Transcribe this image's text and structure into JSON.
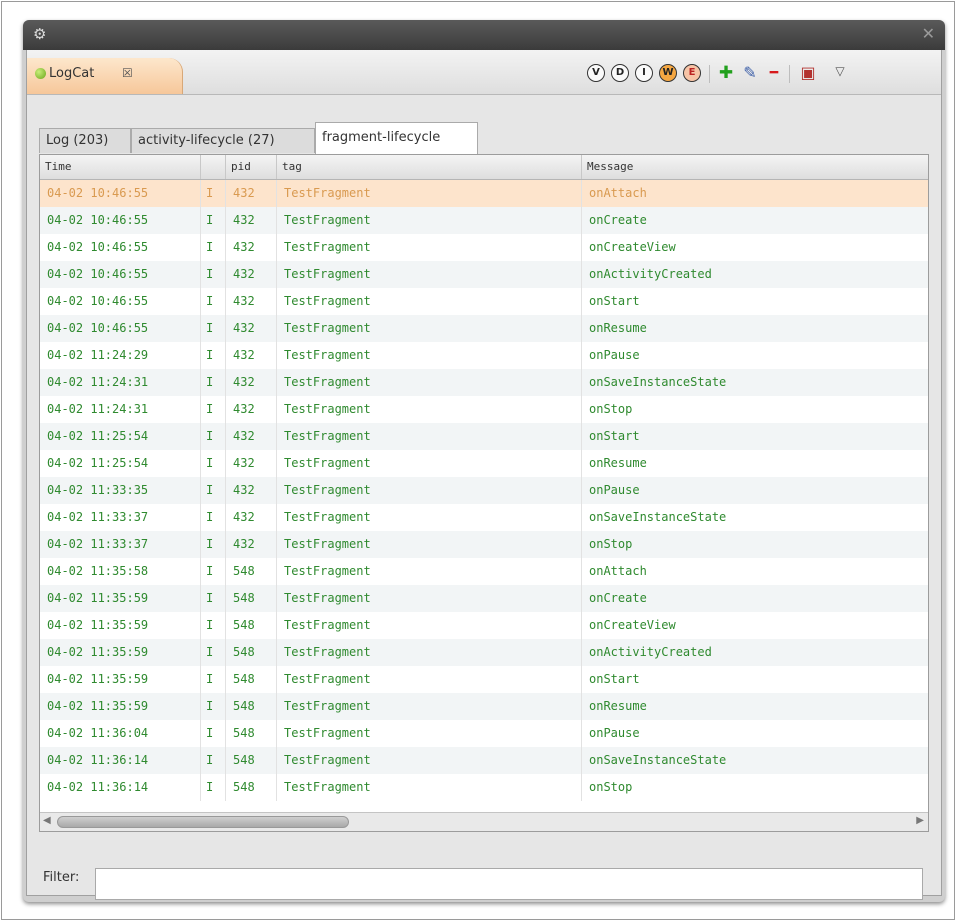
{
  "window": {
    "close_glyph": "✕",
    "app_icon": "gear-icon"
  },
  "view_tab": {
    "label": "LogCat",
    "close_glyph": "☒",
    "icon": "logcat-icon"
  },
  "toolbar": {
    "buttons": [
      {
        "name": "verbose-button",
        "glyph": "V"
      },
      {
        "name": "debug-button",
        "glyph": "D"
      },
      {
        "name": "info-button",
        "glyph": "I"
      },
      {
        "name": "warning-button",
        "glyph": "W"
      },
      {
        "name": "error-button",
        "glyph": "E"
      },
      {
        "name": "add-filter-button",
        "glyph": "✚"
      },
      {
        "name": "edit-filter-button",
        "glyph": "✎"
      },
      {
        "name": "remove-filter-button",
        "glyph": "━"
      },
      {
        "name": "clear-log-button",
        "glyph": "▣"
      },
      {
        "name": "view-menu-button",
        "glyph": "▽"
      }
    ],
    "colors": {
      "info": "#ffffff",
      "warning": "#f5a742",
      "error": "#f7c4a6",
      "add": "#22a01d",
      "remove": "#d7191c"
    }
  },
  "log_tabs": [
    {
      "label": "Log (203)",
      "active": false
    },
    {
      "label": "activity-lifecycle (27)",
      "active": false
    },
    {
      "label": "fragment-lifecycle",
      "active": true
    }
  ],
  "table": {
    "headers": {
      "time": "Time",
      "level": "",
      "pid": "pid",
      "tag": "tag",
      "message": "Message"
    },
    "rows": [
      {
        "time": "04-02 10:46:55",
        "level": "I",
        "pid": "432",
        "tag": "TestFragment",
        "message": "onAttach"
      },
      {
        "time": "04-02 10:46:55",
        "level": "I",
        "pid": "432",
        "tag": "TestFragment",
        "message": "onCreate"
      },
      {
        "time": "04-02 10:46:55",
        "level": "I",
        "pid": "432",
        "tag": "TestFragment",
        "message": "onCreateView"
      },
      {
        "time": "04-02 10:46:55",
        "level": "I",
        "pid": "432",
        "tag": "TestFragment",
        "message": "onActivityCreated"
      },
      {
        "time": "04-02 10:46:55",
        "level": "I",
        "pid": "432",
        "tag": "TestFragment",
        "message": "onStart"
      },
      {
        "time": "04-02 10:46:55",
        "level": "I",
        "pid": "432",
        "tag": "TestFragment",
        "message": "onResume"
      },
      {
        "time": "04-02 11:24:29",
        "level": "I",
        "pid": "432",
        "tag": "TestFragment",
        "message": "onPause"
      },
      {
        "time": "04-02 11:24:31",
        "level": "I",
        "pid": "432",
        "tag": "TestFragment",
        "message": "onSaveInstanceState"
      },
      {
        "time": "04-02 11:24:31",
        "level": "I",
        "pid": "432",
        "tag": "TestFragment",
        "message": "onStop"
      },
      {
        "time": "04-02 11:25:54",
        "level": "I",
        "pid": "432",
        "tag": "TestFragment",
        "message": "onStart"
      },
      {
        "time": "04-02 11:25:54",
        "level": "I",
        "pid": "432",
        "tag": "TestFragment",
        "message": "onResume"
      },
      {
        "time": "04-02 11:33:35",
        "level": "I",
        "pid": "432",
        "tag": "TestFragment",
        "message": "onPause"
      },
      {
        "time": "04-02 11:33:37",
        "level": "I",
        "pid": "432",
        "tag": "TestFragment",
        "message": "onSaveInstanceState"
      },
      {
        "time": "04-02 11:33:37",
        "level": "I",
        "pid": "432",
        "tag": "TestFragment",
        "message": "onStop"
      },
      {
        "time": "04-02 11:35:58",
        "level": "I",
        "pid": "548",
        "tag": "TestFragment",
        "message": "onAttach"
      },
      {
        "time": "04-02 11:35:59",
        "level": "I",
        "pid": "548",
        "tag": "TestFragment",
        "message": "onCreate"
      },
      {
        "time": "04-02 11:35:59",
        "level": "I",
        "pid": "548",
        "tag": "TestFragment",
        "message": "onCreateView"
      },
      {
        "time": "04-02 11:35:59",
        "level": "I",
        "pid": "548",
        "tag": "TestFragment",
        "message": "onActivityCreated"
      },
      {
        "time": "04-02 11:35:59",
        "level": "I",
        "pid": "548",
        "tag": "TestFragment",
        "message": "onStart"
      },
      {
        "time": "04-02 11:35:59",
        "level": "I",
        "pid": "548",
        "tag": "TestFragment",
        "message": "onResume"
      },
      {
        "time": "04-02 11:36:04",
        "level": "I",
        "pid": "548",
        "tag": "TestFragment",
        "message": "onPause"
      },
      {
        "time": "04-02 11:36:14",
        "level": "I",
        "pid": "548",
        "tag": "TestFragment",
        "message": "onSaveInstanceState"
      },
      {
        "time": "04-02 11:36:14",
        "level": "I",
        "pid": "548",
        "tag": "TestFragment",
        "message": "onStop"
      }
    ],
    "selected_row": 0,
    "colors": {
      "info_text": "#2f8a2f",
      "selected_bg": "#fde4cc",
      "selected_text": "#d99a50"
    }
  },
  "filter": {
    "label": "Filter:",
    "value": "",
    "placeholder": ""
  }
}
